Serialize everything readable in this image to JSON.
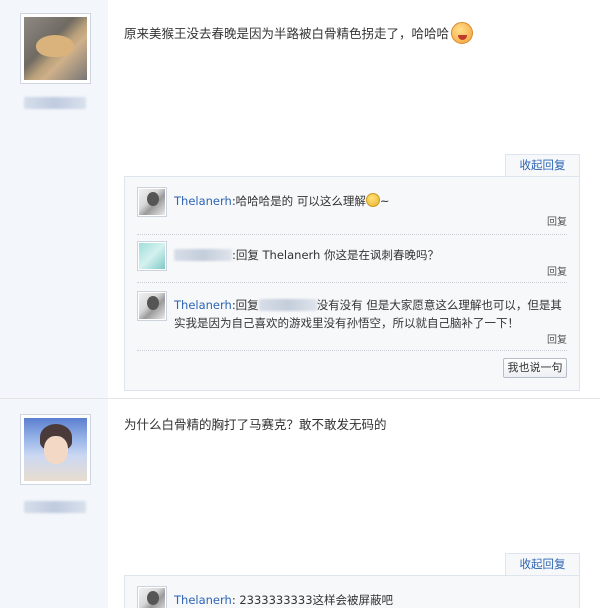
{
  "posts": [
    {
      "content": "原来美猴王没去春晚是因为半路被白骨精色拐走了，哈哈哈",
      "collapse_label": "收起回复",
      "replies": [
        {
          "user": "Thelanerh",
          "text": ":哈哈哈是的 可以这么理解",
          "suffix": "~",
          "reply_label": "回复"
        },
        {
          "user": "",
          "text": ":回复 Thelanerh 你这是在讽刺春晚吗？",
          "reply_label": "回复"
        },
        {
          "user": "Thelanerh",
          "text_pre": ":回复",
          "text_post": "没有没有 但是大家愿意这么理解也可以，但是其实我是因为自己喜欢的游戏里没有孙悟空，所以就自己脑补了一下！",
          "reply_label": "回复"
        }
      ],
      "say_button": "我也说一句"
    },
    {
      "content": "为什么白骨精的胸打了马赛克？敢不敢发无码的",
      "collapse_label": "收起回复",
      "replies": [
        {
          "user": "Thelanerh",
          "text": ": 2333333333这样会被屏蔽吧"
        }
      ]
    }
  ],
  "icons": {
    "post1_avatar": "dog-avatar",
    "post2_avatar": "person-avatar",
    "emoji_laugh": "laughing-face-emoji",
    "emoji_smile": "smile-emoji"
  },
  "colors": {
    "link": "#2d64b3",
    "sidebar_bg": "#f3f6fb",
    "reply_bg": "#f7f8fa"
  }
}
